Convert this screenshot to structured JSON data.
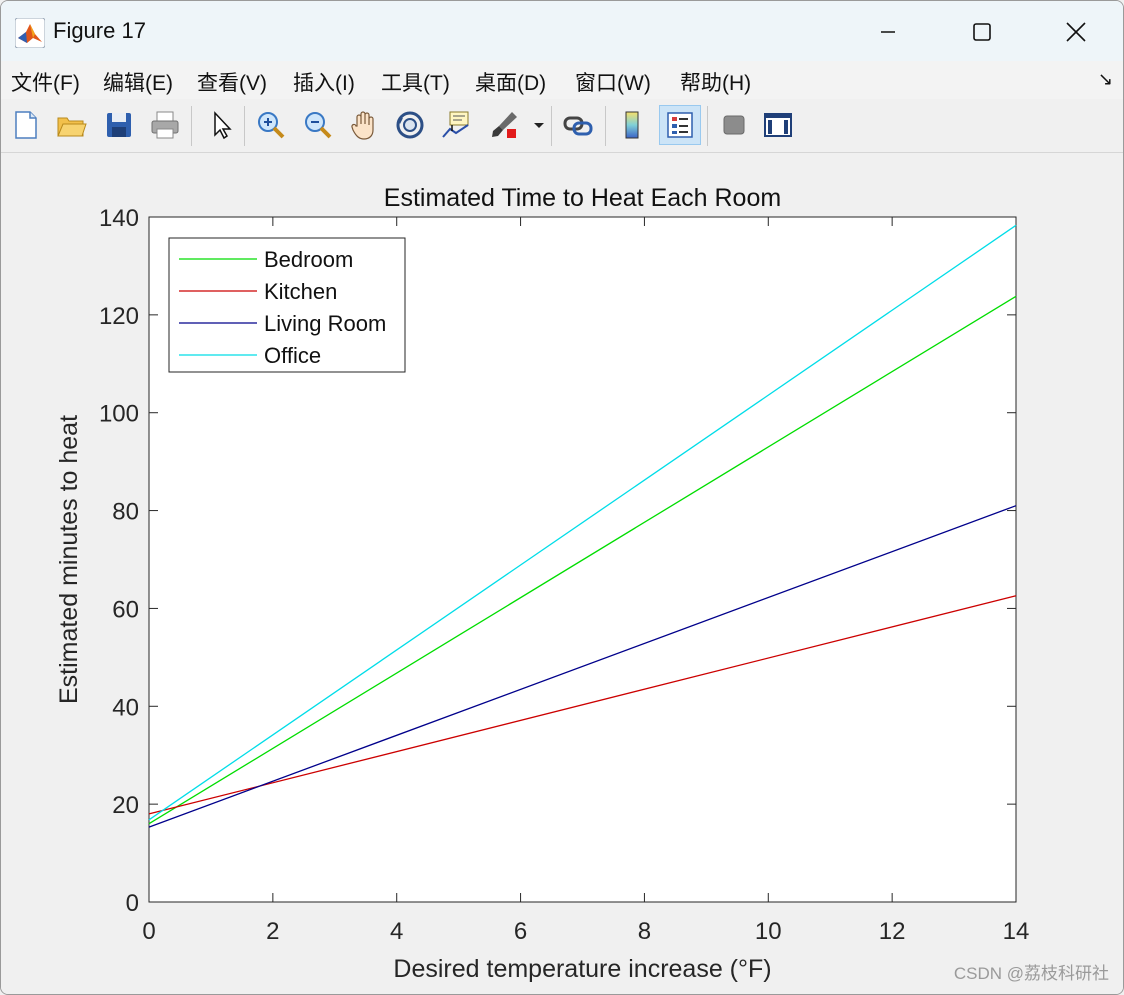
{
  "window": {
    "title": "Figure 17",
    "controls": [
      "minimize",
      "maximize",
      "close"
    ]
  },
  "menu": {
    "items": [
      "文件(F)",
      "编辑(E)",
      "查看(V)",
      "插入(I)",
      "工具(T)",
      "桌面(D)",
      "窗口(W)",
      "帮助(H)"
    ],
    "collapse_glyph": "↘"
  },
  "toolbar": {
    "buttons": [
      {
        "icon": "new-figure-icon"
      },
      {
        "icon": "open-file-icon"
      },
      {
        "icon": "save-icon"
      },
      {
        "icon": "print-icon"
      },
      {
        "icon": "edit-plot-arrow-icon"
      },
      {
        "icon": "zoom-in-icon"
      },
      {
        "icon": "zoom-out-icon"
      },
      {
        "icon": "pan-hand-icon"
      },
      {
        "icon": "rotate-3d-icon"
      },
      {
        "icon": "data-cursor-icon"
      },
      {
        "icon": "brush-icon"
      },
      {
        "icon": "link-plot-icon"
      },
      {
        "icon": "colorbar-icon"
      },
      {
        "icon": "legend-icon",
        "active": true
      },
      {
        "icon": "hide-plot-tools-icon"
      },
      {
        "icon": "show-plot-tools-icon"
      }
    ]
  },
  "chart_data": {
    "type": "line",
    "title": "Estimated Time to Heat Each Room",
    "xlabel": "Desired temperature increase (°F)",
    "ylabel": "Estimated minutes to heat",
    "xlim": [
      0,
      14
    ],
    "ylim": [
      0,
      140
    ],
    "xticks": [
      0,
      2,
      4,
      6,
      8,
      10,
      12,
      14
    ],
    "yticks": [
      0,
      20,
      40,
      60,
      80,
      100,
      120,
      140
    ],
    "grid": false,
    "legend_position": "top-left",
    "series": [
      {
        "name": "Bedroom",
        "color": "#00dd00",
        "x": [
          0,
          14
        ],
        "y": [
          16.0,
          123.8
        ]
      },
      {
        "name": "Kitchen",
        "color": "#cc0000",
        "x": [
          0,
          14
        ],
        "y": [
          18.0,
          62.6
        ]
      },
      {
        "name": "Living Room",
        "color": "#00008b",
        "x": [
          0,
          14
        ],
        "y": [
          15.3,
          81.0
        ]
      },
      {
        "name": "Office",
        "color": "#00dde8",
        "x": [
          0,
          14
        ],
        "y": [
          16.8,
          138.3
        ]
      }
    ]
  },
  "watermark": "CSDN @荔枝科研社"
}
